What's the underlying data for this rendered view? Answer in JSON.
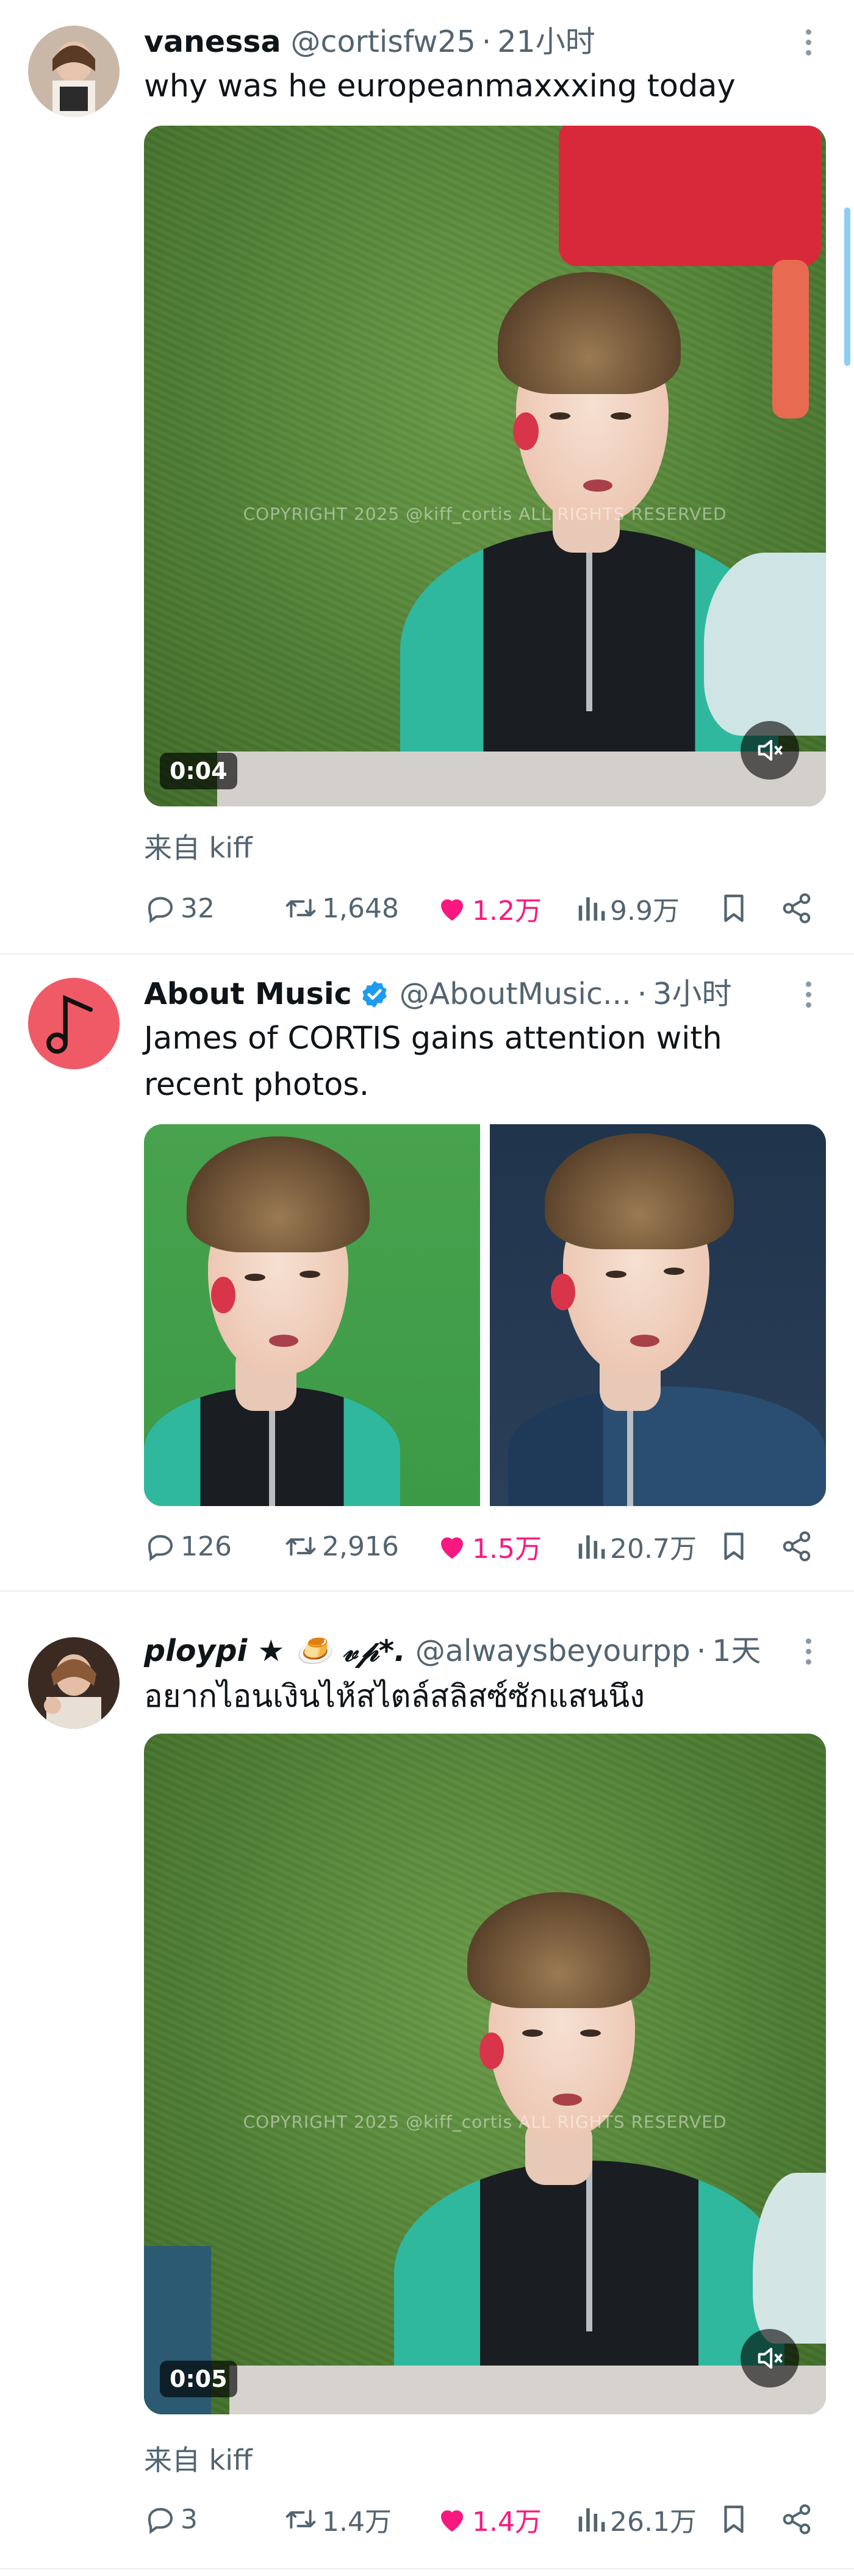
{
  "tweets": [
    {
      "author": {
        "name": "vanessa",
        "handle": "@cortisfw25",
        "time": "21小时"
      },
      "text": "why was he europeanmaxxxing today",
      "media": {
        "type": "video",
        "duration": "0:04",
        "watermark": "COPYRIGHT 2025 @kiff_cortis ALL RIGHTS RESERVED"
      },
      "source": "来自 kiff",
      "stats": {
        "replies": "32",
        "reposts": "1,648",
        "likes": "1.2万",
        "views": "9.9万"
      }
    },
    {
      "author": {
        "name": "About Music",
        "handle": "@AboutMusic...",
        "time": "3小时",
        "verified": true
      },
      "text": "James of CORTIS gains attention with recent photos.",
      "media": {
        "type": "photos",
        "count": 2
      },
      "stats": {
        "replies": "126",
        "reposts": "2,916",
        "likes": "1.5万",
        "views": "20.7万"
      }
    },
    {
      "author": {
        "name": "ploypi ★ 🍮 𝓋𝓅*.",
        "handle": "@alwaysbeyourpp",
        "time": "1天"
      },
      "text": "อยากไอนเงินไห้สไตล์สลิสซ์ซักแสนนึง",
      "media": {
        "type": "video",
        "duration": "0:05",
        "watermark": "COPYRIGHT 2025 @kiff_cortis ALL RIGHTS RESERVED"
      },
      "source": "来自 kiff",
      "stats": {
        "replies": "3",
        "reposts": "1.4万",
        "likes": "1.4万",
        "views": "26.1万"
      }
    }
  ],
  "colors": {
    "accent": "#1d9bf0",
    "like": "#f91880",
    "muted": "#536471",
    "text": "#0f1419"
  },
  "icons": [
    "more-icon",
    "verified-icon",
    "reply-icon",
    "repost-icon",
    "like-icon",
    "views-icon",
    "bookmark-icon",
    "share-icon",
    "volume-icon"
  ]
}
